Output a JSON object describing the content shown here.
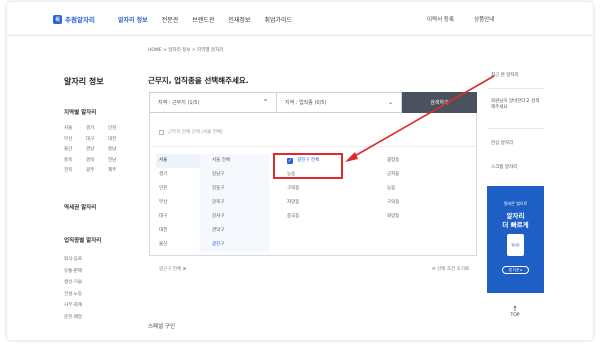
{
  "header": {
    "logo_mark": "워",
    "logo_text": "추첨알자리",
    "nav": [
      "알자리 정보",
      "전문관",
      "브랜드관",
      "인재정보",
      "취업가이드"
    ],
    "active_index": 0,
    "right": [
      "이력서 등록",
      "상품안내"
    ]
  },
  "breadcrumb": "HOME > 알자리 정보 > 지역별 알자리",
  "sidebar": {
    "title": "알자리 정보",
    "section_region": "지역별 알자리",
    "regions": [
      "서울",
      "경기",
      "인천",
      "부산",
      "대구",
      "대전",
      "울산",
      "경남",
      "충남",
      "충북",
      "경북",
      "전남",
      "전북",
      "광주",
      "제주"
    ],
    "section_station": "역세권 알자리",
    "section_industry": "업직종별 알자리",
    "industries": [
      "외식·음료",
      "유통·판매",
      "생산·기술",
      "건설·노동",
      "사무·회계",
      "운전·배달"
    ]
  },
  "main": {
    "title": "근무지, 업직종을 선택해주세요.",
    "select_region": "지역 : 근무지 (1/5)",
    "select_job": "지역 : 업직종 (0/5)",
    "search_button": "검색하기",
    "check_all_label": "근무지 전체 선택 (서울 전체)",
    "regions": [
      "서울",
      "경기",
      "인천",
      "부산",
      "대구",
      "대전",
      "울산"
    ],
    "districts": [
      "서울 전체",
      "강남구",
      "강동구",
      "강북구",
      "강서구",
      "관악구",
      "광진구"
    ],
    "selected_district": "광진구 전체",
    "sub_districts": [
      "능동",
      "구의동",
      "자양동",
      "중곡동",
      "화양동"
    ],
    "sub_districts_right": [
      "광장동",
      "군자동",
      "능동",
      "구의동",
      "화양동"
    ],
    "footer_left": "알근구 전체 ⊗",
    "footer_right": "⟳ 선택 조건 초기화",
    "bottom_title": "스페셜 구인"
  },
  "rail": {
    "item1": "최근 본 알자리",
    "item2": "회원님이 알바한다고 검색해주세요",
    "item3": "관심 알자리",
    "item4": "스크랩 알자리",
    "banner_small": "알바몬 앱으로",
    "banner_line1": "알자리",
    "banner_line2": "더 빠르게",
    "banner_card": "알바몬",
    "banner_cta": "앱 다운 ▸",
    "top_label": "TOP"
  }
}
